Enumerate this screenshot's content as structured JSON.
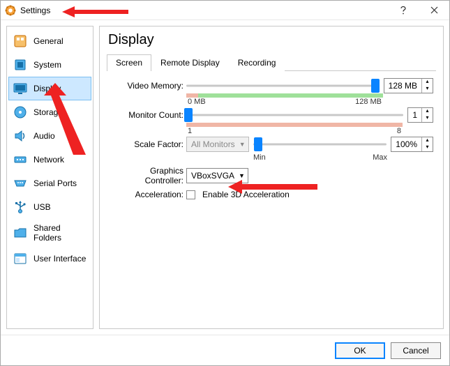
{
  "window": {
    "title": "Settings"
  },
  "sidebar": {
    "items": [
      {
        "label": "General"
      },
      {
        "label": "System"
      },
      {
        "label": "Display"
      },
      {
        "label": "Storage"
      },
      {
        "label": "Audio"
      },
      {
        "label": "Network"
      },
      {
        "label": "Serial Ports"
      },
      {
        "label": "USB"
      },
      {
        "label": "Shared Folders"
      },
      {
        "label": "User Interface"
      }
    ],
    "selected_index": 2
  },
  "page": {
    "title": "Display",
    "tabs": [
      "Screen",
      "Remote Display",
      "Recording"
    ],
    "active_tab_index": 0
  },
  "form": {
    "video_memory": {
      "label": "Video Memory:",
      "value": "128 MB",
      "min_label": "0 MB",
      "max_label": "128 MB"
    },
    "monitor_count": {
      "label": "Monitor Count:",
      "value": "1",
      "min_label": "1",
      "max_label": "8"
    },
    "scale_factor": {
      "label": "Scale Factor:",
      "dropdown": "All Monitors",
      "value": "100%",
      "min_label": "Min",
      "max_label": "Max"
    },
    "graphics_controller": {
      "label": "Graphics Controller:",
      "value": "VBoxSVGA"
    },
    "acceleration": {
      "label": "Acceleration:",
      "checkbox_label": "Enable 3D Acceleration",
      "checked": false
    }
  },
  "footer": {
    "ok": "OK",
    "cancel": "Cancel"
  }
}
